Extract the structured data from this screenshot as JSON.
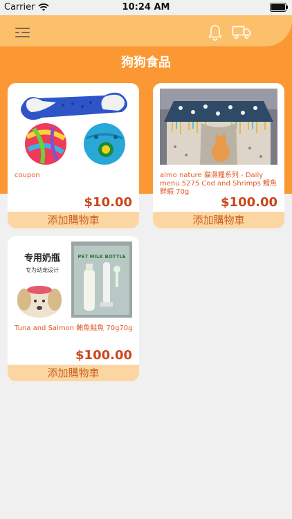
{
  "status_bar": {
    "carrier": "Carrier",
    "time": "10:24 AM"
  },
  "header": {
    "title": "狗狗食品",
    "icons": [
      "menu-icon",
      "bell-icon",
      "truck-icon"
    ]
  },
  "colors": {
    "accent_orange": "#fb9833",
    "header_light_orange": "#fcc06b",
    "price_text": "#c8471c",
    "name_text": "#e05a24",
    "cart_button_bg": "#fcd6a2"
  },
  "products": [
    {
      "name": "coupon",
      "price": "$10.00",
      "cart_label": "添加購物車"
    },
    {
      "name": "almo nature 貓濕糧系列 - Daily menu 5275 Cod and Shrimps 鱈魚鮮蝦 70g",
      "price": "$100.00",
      "cart_label": "添加購物車"
    },
    {
      "name": "Tuna and Salmon 鮪魚鮭魚 70g70g",
      "price": "$100.00",
      "cart_label": "添加購物車",
      "image_text": {
        "heading": "专用奶瓶",
        "subheading": "专为幼宠设计",
        "bottle_label": "PET MILK BOTTLE"
      }
    }
  ]
}
